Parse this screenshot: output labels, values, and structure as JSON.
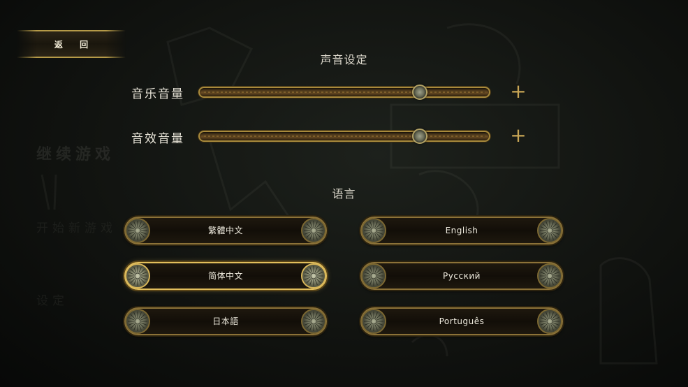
{
  "back_button": {
    "label": "返 回"
  },
  "background_menu": [
    {
      "label": "继续游戏"
    },
    {
      "label": "开始新游戏"
    },
    {
      "label": "设定"
    }
  ],
  "sound": {
    "heading": "声音设定",
    "sliders": [
      {
        "label": "音乐音量",
        "value_fraction": 0.76
      },
      {
        "label": "音效音量",
        "value_fraction": 0.76
      }
    ],
    "plus_label": "+"
  },
  "language": {
    "heading": "语言",
    "selected": "简体中文",
    "options": [
      {
        "label": "繁體中文"
      },
      {
        "label": "English"
      },
      {
        "label": "简体中文"
      },
      {
        "label": "Русский"
      },
      {
        "label": "日本語"
      },
      {
        "label": "Português"
      }
    ]
  },
  "colors": {
    "gold_accent": "#c8a555",
    "selected_border": "#e2bf5c",
    "text": "#f0ecdf"
  }
}
